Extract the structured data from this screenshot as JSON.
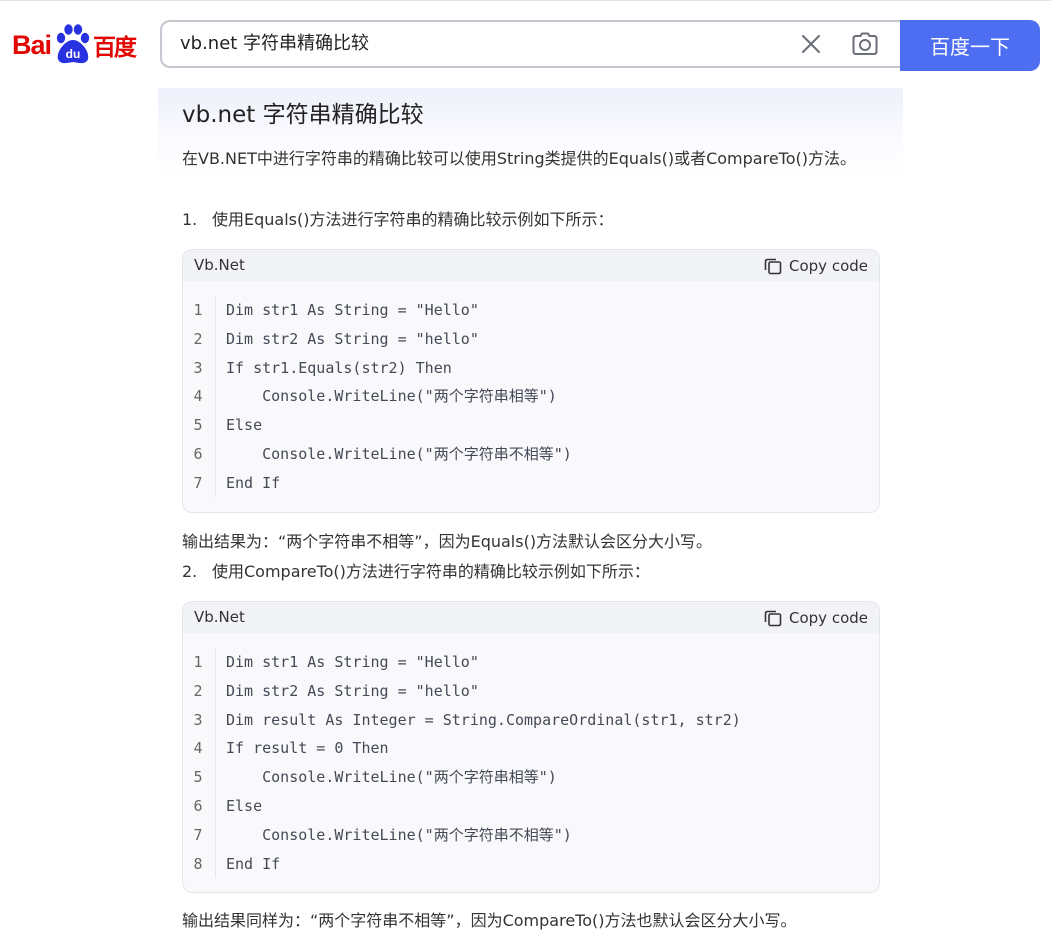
{
  "brand": {
    "logo_left": "Bai",
    "logo_paw": "du",
    "logo_right": "百度",
    "colors": {
      "logo_red": "#e10602",
      "logo_blue": "#2932e1",
      "accent": "#4e6ef2"
    }
  },
  "search": {
    "query": "vb.net 字符串精确比较",
    "button_label": "百度一下",
    "clear_icon": "close-icon",
    "camera_icon": "camera-icon"
  },
  "answer": {
    "title": "vb.net 字符串精确比较",
    "intro": "在VB.NET中进行字符串的精确比较可以使用String类提供的Equals()或者CompareTo()方法。",
    "step1": {
      "num": "1.",
      "text": "使用Equals()方法进行字符串的精确比较示例如下所示："
    },
    "code1": {
      "lang": "Vb.Net",
      "copy_label": "Copy code",
      "lines": [
        {
          "n": "1",
          "code": "Dim str1 As String = \"Hello\""
        },
        {
          "n": "2",
          "code": "Dim str2 As String = \"hello\""
        },
        {
          "n": "3",
          "code": "If str1.Equals(str2) Then"
        },
        {
          "n": "4",
          "code": "    Console.WriteLine(\"两个字符串相等\")"
        },
        {
          "n": "5",
          "code": "Else"
        },
        {
          "n": "6",
          "code": "    Console.WriteLine(\"两个字符串不相等\")"
        },
        {
          "n": "7",
          "code": "End If"
        }
      ]
    },
    "result1": "输出结果为：“两个字符串不相等”，因为Equals()方法默认会区分大小写。",
    "step2": {
      "num": "2.",
      "text": "使用CompareTo()方法进行字符串的精确比较示例如下所示："
    },
    "code2": {
      "lang": "Vb.Net",
      "copy_label": "Copy code",
      "lines": [
        {
          "n": "1",
          "code": "Dim str1 As String = \"Hello\""
        },
        {
          "n": "2",
          "code": "Dim str2 As String = \"hello\""
        },
        {
          "n": "3",
          "code": "Dim result As Integer = String.CompareOrdinal(str1, str2)"
        },
        {
          "n": "4",
          "code": "If result = 0 Then"
        },
        {
          "n": "5",
          "code": "    Console.WriteLine(\"两个字符串相等\")"
        },
        {
          "n": "6",
          "code": "Else"
        },
        {
          "n": "7",
          "code": "    Console.WriteLine(\"两个字符串不相等\")"
        },
        {
          "n": "8",
          "code": "End If"
        }
      ]
    },
    "result2": "输出结果同样为：“两个字符串不相等”，因为CompareTo()方法也默认会区分大小写。"
  }
}
